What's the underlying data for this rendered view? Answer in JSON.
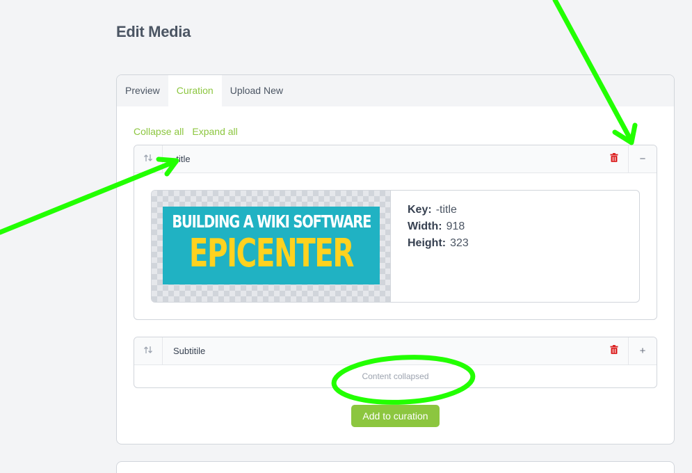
{
  "page": {
    "title": "Edit Media"
  },
  "tabs": [
    {
      "label": "Preview"
    },
    {
      "label": "Curation",
      "active": true
    },
    {
      "label": "Upload New"
    }
  ],
  "actions": {
    "collapse_all": "Collapse all",
    "expand_all": "Expand all"
  },
  "items": [
    {
      "label": "-title",
      "toggle": "−",
      "expanded": true,
      "thumbnail": {
        "line1": "BUILDING A WIKI SOFTWARE",
        "line2": "EPICENTER"
      },
      "meta": {
        "key_label": "Key:",
        "key": "-title",
        "width_label": "Width:",
        "width": "918",
        "height_label": "Height:",
        "height": "323"
      }
    },
    {
      "label": "Subtitile",
      "toggle": "+",
      "expanded": false,
      "collapsed_text": "Content collapsed"
    }
  ],
  "add_button": "Add to curation",
  "colors": {
    "accent": "#8cc63f",
    "danger": "#dc2626",
    "annotation": "#22ff00"
  },
  "icons": {
    "handle": "sort-arrows-icon",
    "delete": "trash-icon"
  }
}
